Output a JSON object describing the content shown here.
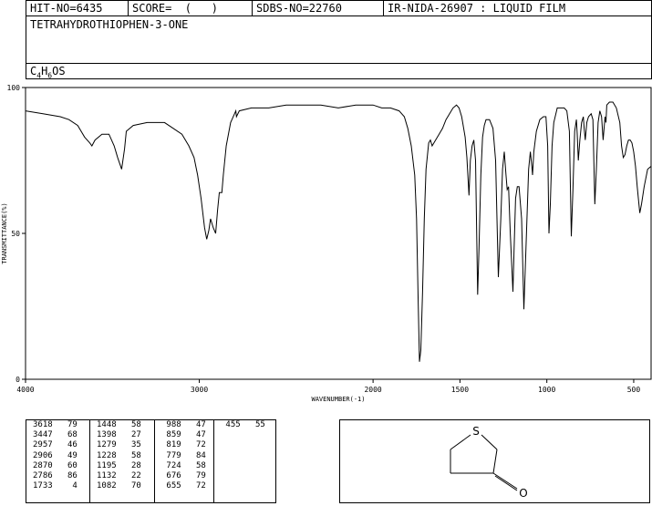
{
  "header": {
    "hit_no": "HIT-NO=6435",
    "score": "SCORE=  (   )",
    "sdbs_no": "SDBS-NO=22760",
    "ir_info": "IR-NIDA-26907 : LIQUID FILM"
  },
  "compound": {
    "name": "TETRAHYDROTHIOPHEN-3-ONE",
    "formula_parts": [
      "C",
      "4",
      "H",
      "6",
      "OS"
    ]
  },
  "chart_data": {
    "type": "line",
    "xlabel": "WAVENUMBER(-1)",
    "ylabel": "TRANSMITTANCE(%)",
    "xlim": [
      4000,
      400
    ],
    "ylim": [
      0,
      100
    ],
    "x_ticks": [
      4000,
      3000,
      2000,
      1500,
      1000,
      500
    ],
    "x_tick_labels": [
      "4000",
      "3000",
      "2000",
      "1500",
      "1000",
      "500"
    ],
    "y_ticks": [
      0,
      50,
      100
    ],
    "y_tick_labels": [
      "0",
      "50",
      "100"
    ],
    "series": [
      {
        "points": [
          [
            4000,
            92
          ],
          [
            3900,
            91
          ],
          [
            3800,
            90
          ],
          [
            3750,
            89
          ],
          [
            3700,
            87
          ],
          [
            3660,
            83
          ],
          [
            3630,
            81
          ],
          [
            3618,
            80
          ],
          [
            3600,
            82
          ],
          [
            3560,
            84
          ],
          [
            3520,
            84
          ],
          [
            3490,
            80
          ],
          [
            3470,
            76
          ],
          [
            3447,
            72
          ],
          [
            3430,
            79
          ],
          [
            3420,
            85
          ],
          [
            3380,
            87
          ],
          [
            3300,
            88
          ],
          [
            3250,
            88
          ],
          [
            3200,
            88
          ],
          [
            3150,
            86
          ],
          [
            3100,
            84
          ],
          [
            3060,
            80
          ],
          [
            3030,
            76
          ],
          [
            3010,
            70
          ],
          [
            2990,
            62
          ],
          [
            2970,
            52
          ],
          [
            2957,
            48
          ],
          [
            2945,
            51
          ],
          [
            2935,
            55
          ],
          [
            2920,
            52
          ],
          [
            2906,
            50
          ],
          [
            2895,
            58
          ],
          [
            2885,
            64
          ],
          [
            2870,
            64
          ],
          [
            2862,
            70
          ],
          [
            2845,
            80
          ],
          [
            2820,
            88
          ],
          [
            2790,
            92
          ],
          [
            2786,
            90
          ],
          [
            2770,
            92
          ],
          [
            2700,
            93
          ],
          [
            2600,
            93
          ],
          [
            2500,
            94
          ],
          [
            2400,
            94
          ],
          [
            2300,
            94
          ],
          [
            2200,
            93
          ],
          [
            2100,
            94
          ],
          [
            2000,
            94
          ],
          [
            1950,
            93
          ],
          [
            1900,
            93
          ],
          [
            1850,
            92
          ],
          [
            1820,
            90
          ],
          [
            1800,
            86
          ],
          [
            1780,
            80
          ],
          [
            1760,
            70
          ],
          [
            1750,
            55
          ],
          [
            1740,
            25
          ],
          [
            1733,
            6
          ],
          [
            1725,
            10
          ],
          [
            1715,
            30
          ],
          [
            1705,
            55
          ],
          [
            1695,
            72
          ],
          [
            1680,
            81
          ],
          [
            1670,
            82
          ],
          [
            1660,
            80
          ],
          [
            1640,
            82
          ],
          [
            1620,
            84
          ],
          [
            1600,
            86
          ],
          [
            1580,
            89
          ],
          [
            1560,
            91
          ],
          [
            1540,
            93
          ],
          [
            1520,
            94
          ],
          [
            1505,
            93
          ],
          [
            1490,
            90
          ],
          [
            1470,
            83
          ],
          [
            1460,
            76
          ],
          [
            1448,
            63
          ],
          [
            1440,
            75
          ],
          [
            1430,
            80
          ],
          [
            1420,
            82
          ],
          [
            1410,
            75
          ],
          [
            1398,
            29
          ],
          [
            1390,
            45
          ],
          [
            1380,
            70
          ],
          [
            1370,
            83
          ],
          [
            1360,
            87
          ],
          [
            1350,
            89
          ],
          [
            1330,
            89
          ],
          [
            1310,
            86
          ],
          [
            1295,
            75
          ],
          [
            1279,
            35
          ],
          [
            1265,
            55
          ],
          [
            1255,
            72
          ],
          [
            1245,
            78
          ],
          [
            1235,
            70
          ],
          [
            1228,
            65
          ],
          [
            1220,
            66
          ],
          [
            1210,
            50
          ],
          [
            1195,
            30
          ],
          [
            1188,
            45
          ],
          [
            1180,
            62
          ],
          [
            1170,
            66
          ],
          [
            1160,
            66
          ],
          [
            1145,
            55
          ],
          [
            1132,
            24
          ],
          [
            1120,
            45
          ],
          [
            1105,
            72
          ],
          [
            1095,
            78
          ],
          [
            1085,
            72
          ],
          [
            1082,
            70
          ],
          [
            1075,
            78
          ],
          [
            1060,
            85
          ],
          [
            1040,
            89
          ],
          [
            1020,
            90
          ],
          [
            1005,
            90
          ],
          [
            995,
            80
          ],
          [
            988,
            50
          ],
          [
            980,
            60
          ],
          [
            970,
            80
          ],
          [
            960,
            88
          ],
          [
            940,
            93
          ],
          [
            920,
            93
          ],
          [
            900,
            93
          ],
          [
            885,
            92
          ],
          [
            870,
            85
          ],
          [
            859,
            49
          ],
          [
            850,
            65
          ],
          [
            840,
            85
          ],
          [
            830,
            89
          ],
          [
            825,
            84
          ],
          [
            819,
            75
          ],
          [
            810,
            82
          ],
          [
            800,
            88
          ],
          [
            790,
            90
          ],
          [
            785,
            86
          ],
          [
            779,
            82
          ],
          [
            770,
            88
          ],
          [
            760,
            90
          ],
          [
            745,
            91
          ],
          [
            735,
            89
          ],
          [
            724,
            60
          ],
          [
            715,
            72
          ],
          [
            705,
            88
          ],
          [
            695,
            92
          ],
          [
            685,
            90
          ],
          [
            676,
            82
          ],
          [
            665,
            90
          ],
          [
            660,
            88
          ],
          [
            655,
            94
          ],
          [
            640,
            95
          ],
          [
            620,
            95
          ],
          [
            600,
            93
          ],
          [
            580,
            88
          ],
          [
            570,
            80
          ],
          [
            560,
            76
          ],
          [
            550,
            77
          ],
          [
            540,
            80
          ],
          [
            530,
            82
          ],
          [
            520,
            82
          ],
          [
            510,
            81
          ],
          [
            500,
            78
          ],
          [
            490,
            73
          ],
          [
            480,
            66
          ],
          [
            465,
            57
          ],
          [
            455,
            60
          ],
          [
            440,
            66
          ],
          [
            420,
            72
          ],
          [
            400,
            73
          ]
        ]
      }
    ],
    "peak_table": [
      {
        "wn": "3618",
        "t": "79"
      },
      {
        "wn": "3447",
        "t": "68"
      },
      {
        "wn": "2957",
        "t": "46"
      },
      {
        "wn": "2906",
        "t": "49"
      },
      {
        "wn": "2870",
        "t": "60"
      },
      {
        "wn": "2786",
        "t": "86"
      },
      {
        "wn": "1733",
        "t": "4"
      },
      {
        "wn": "1448",
        "t": "58"
      },
      {
        "wn": "1398",
        "t": "27"
      },
      {
        "wn": "1279",
        "t": "35"
      },
      {
        "wn": "1228",
        "t": "58"
      },
      {
        "wn": "1195",
        "t": "28"
      },
      {
        "wn": "1132",
        "t": "22"
      },
      {
        "wn": "1082",
        "t": "70"
      },
      {
        "wn": "988",
        "t": "47"
      },
      {
        "wn": "859",
        "t": "47"
      },
      {
        "wn": "819",
        "t": "72"
      },
      {
        "wn": "779",
        "t": "84"
      },
      {
        "wn": "724",
        "t": "58"
      },
      {
        "wn": "676",
        "t": "79"
      },
      {
        "wn": "655",
        "t": "72"
      },
      {
        "wn": "455",
        "t": "55"
      }
    ]
  },
  "structure": {
    "atom_s": "S",
    "atom_o": "O"
  }
}
